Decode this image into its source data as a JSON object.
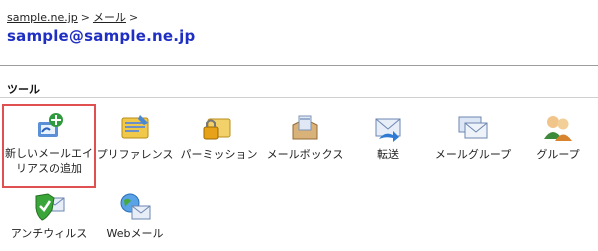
{
  "breadcrumb": {
    "domain": "sample.ne.jp",
    "sep1": ">",
    "mail": "メール",
    "sep2": ">"
  },
  "page_title": "sample@sample.ne.jp",
  "section_title": "ツール",
  "tools": [
    {
      "label": "新しいメールエイリアスの追加",
      "line1": "新しいメールエイ",
      "line2": "リアスの追加",
      "icon": "add-alias-icon",
      "selected": true
    },
    {
      "label": "プリファレンス",
      "icon": "preferences-icon"
    },
    {
      "label": "パーミッション",
      "icon": "permissions-lock-icon"
    },
    {
      "label": "メールボックス",
      "icon": "mailbox-icon"
    },
    {
      "label": "転送",
      "icon": "forward-mail-icon"
    },
    {
      "label": "メールグループ",
      "icon": "mail-group-icon"
    },
    {
      "label": "グループ",
      "icon": "group-users-icon"
    },
    {
      "label": "アンチウィルス",
      "icon": "antivirus-shield-icon"
    },
    {
      "label": "Webメール",
      "icon": "webmail-globe-icon"
    }
  ],
  "colors": {
    "title": "#1f2fc4",
    "highlight": "#e05050"
  }
}
